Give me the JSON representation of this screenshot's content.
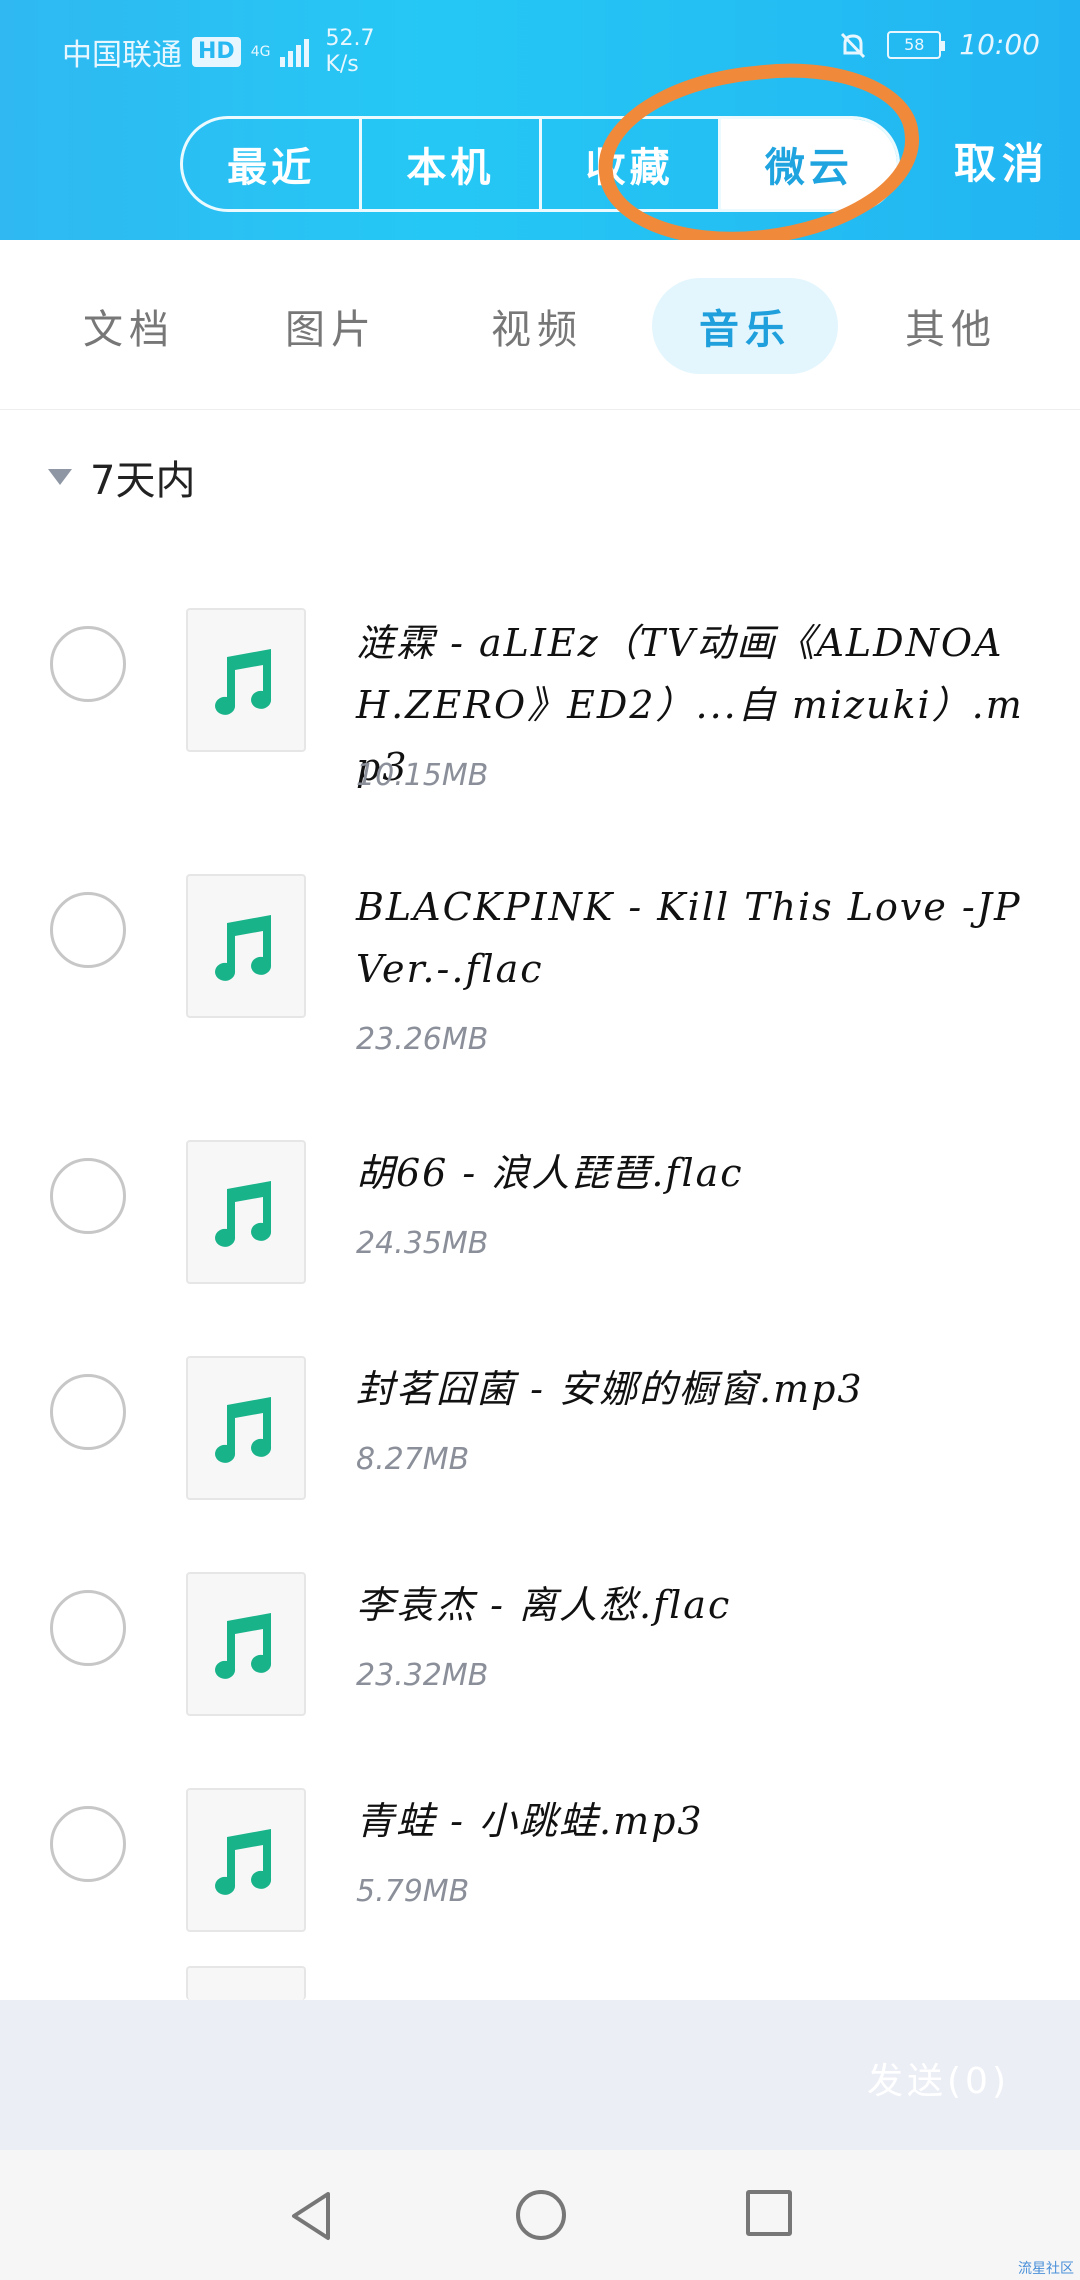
{
  "statusbar": {
    "carrier": "中国联通",
    "hd": "HD",
    "network": "4G",
    "speed_value": "52.7",
    "speed_unit": "K/s",
    "battery": "58",
    "time": "10:00"
  },
  "top_nav": {
    "segments": [
      "最近",
      "本机",
      "收藏",
      "微云"
    ],
    "active_segment": "微云",
    "cancel_label": "取消"
  },
  "categories": {
    "items": [
      "文档",
      "图片",
      "视频",
      "音乐",
      "其他"
    ],
    "active": "音乐"
  },
  "section": {
    "title": "7天内"
  },
  "files": [
    {
      "name": "涟霖 - aLIEz（TV动画《ALDNOAH.ZERO》ED2）...自 mizuki）.mp3",
      "size": "10.15MB"
    },
    {
      "name": "BLACKPINK - Kill This Love -JP Ver.-.flac",
      "size": "23.26MB"
    },
    {
      "name": "胡66 - 浪人琵琶.flac",
      "size": "24.35MB"
    },
    {
      "name": "封茗囧菌 - 安娜的橱窗.mp3",
      "size": "8.27MB"
    },
    {
      "name": "李袁杰 - 离人愁.flac",
      "size": "23.32MB"
    },
    {
      "name": "青蛙 - 小跳蛙.mp3",
      "size": "5.79MB"
    }
  ],
  "sendbar": {
    "send_label": "发送(0)"
  },
  "colors": {
    "header": "#25c8f4",
    "accent": "#1f9fdc",
    "music_icon": "#19b38a",
    "annotation": "#f08a3a"
  },
  "watermark": "流星社区"
}
